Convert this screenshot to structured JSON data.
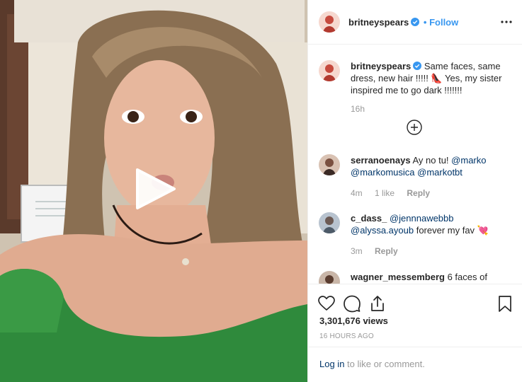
{
  "post": {
    "username": "britneyspears",
    "follow_separator": "•",
    "follow_label": "Follow",
    "more_icon": "three-dots-icon",
    "caption": "Same faces, same dress, new hair !!!!! 👠 Yes, my sister inspired me to go dark !!!!!!!",
    "caption_time": "16h",
    "load_more_icon": "plus-circle-icon"
  },
  "comments": [
    {
      "username": "serranoenays",
      "text_before": "Ay no tu!",
      "mentions": [
        "@marko",
        "@markomusica",
        "@markotbt"
      ],
      "text_after": "",
      "time": "4m",
      "likes": "1 like",
      "reply": "Reply"
    },
    {
      "username": "c_dass_",
      "text_before": "",
      "mentions": [
        "@jennnawebbb",
        "@alyssa.ayoub"
      ],
      "text_after": "forever my fav 💘",
      "time": "3m",
      "likes": "",
      "reply": "Reply"
    },
    {
      "username": "wagner_messemberg",
      "text_before": "6 faces of",
      "mentions": [],
      "text_after": "",
      "time": "",
      "likes": "",
      "reply": ""
    }
  ],
  "actions": {
    "icons": [
      "heart-icon",
      "comment-icon",
      "share-icon",
      "bookmark-icon"
    ],
    "views": "3,301,676 views",
    "posted": "16 HOURS AGO",
    "login_link": "Log in",
    "login_suffix": "to like or comment."
  },
  "colors": {
    "link_blue": "#3897f0",
    "mention_blue": "#003569",
    "muted": "#999999",
    "divider": "#efefef",
    "verified_blue": "#3897f0"
  }
}
